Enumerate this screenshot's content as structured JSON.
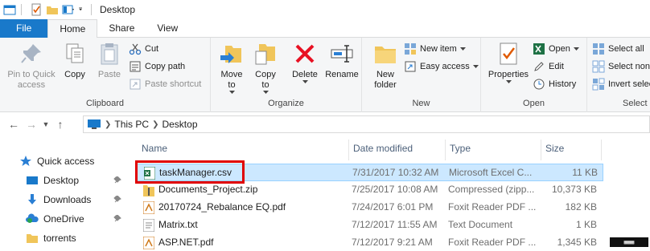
{
  "window": {
    "title": "Desktop"
  },
  "tabs": [
    {
      "label": "File"
    },
    {
      "label": "Home"
    },
    {
      "label": "Share"
    },
    {
      "label": "View"
    }
  ],
  "ribbon": {
    "clipboard": {
      "label": "Clipboard",
      "pin": "Pin to Quick access",
      "pin_line1": "Pin to Quick",
      "pin_line2": "access",
      "copy": "Copy",
      "paste": "Paste",
      "cut": "Cut",
      "copy_path": "Copy path",
      "paste_shortcut": "Paste shortcut"
    },
    "organize": {
      "label": "Organize",
      "move_line1": "Move",
      "move_line2": "to",
      "copy_line1": "Copy",
      "copy_line2": "to",
      "delete": "Delete",
      "rename": "Rename"
    },
    "new": {
      "label": "New",
      "new_folder_line1": "New",
      "new_folder_line2": "folder",
      "new_item": "New item",
      "easy_access": "Easy access"
    },
    "open": {
      "label": "Open",
      "properties": "Properties",
      "open": "Open",
      "edit": "Edit",
      "history": "History"
    },
    "select": {
      "label": "Select",
      "select_all": "Select all",
      "select_none": "Select none",
      "invert_selection": "Invert selection"
    }
  },
  "address": {
    "crumbs": [
      "This PC",
      "Desktop"
    ]
  },
  "navpane": {
    "items": [
      {
        "label": "Quick access",
        "icon": "star-icon"
      },
      {
        "label": "Desktop",
        "icon": "desktop-icon"
      },
      {
        "label": "Downloads",
        "icon": "download-icon"
      },
      {
        "label": "OneDrive",
        "icon": "cloud-icon"
      },
      {
        "label": "torrents",
        "icon": "folder-icon"
      }
    ]
  },
  "filelist": {
    "columns": [
      "Name",
      "Date modified",
      "Type",
      "Size"
    ],
    "rows": [
      {
        "name": "taskManager.csv",
        "date": "7/31/2017 10:32 AM",
        "type": "Microsoft Excel C...",
        "size": "11 KB",
        "icon": "excel-icon",
        "selected": true
      },
      {
        "name": "Documents_Project.zip",
        "date": "7/25/2017 10:08 AM",
        "type": "Compressed (zipp...",
        "size": "10,373 KB",
        "icon": "zip-icon"
      },
      {
        "name": "20170724_Rebalance EQ.pdf",
        "date": "7/24/2017 6:01 PM",
        "type": "Foxit Reader PDF ...",
        "size": "182 KB",
        "icon": "pdf-icon"
      },
      {
        "name": "Matrix.txt",
        "date": "7/12/2017 11:55 AM",
        "type": "Text Document",
        "size": "1 KB",
        "icon": "text-icon"
      },
      {
        "name": "ASP.NET.pdf",
        "date": "7/12/2017 9:21 AM",
        "type": "Foxit Reader PDF ...",
        "size": "1,345 KB",
        "icon": "pdf-icon"
      }
    ]
  },
  "colors": {
    "file_tab": "#1979ca",
    "selection": "#cce8ff",
    "highlight": "#e00000",
    "delete_red": "#e81123"
  }
}
